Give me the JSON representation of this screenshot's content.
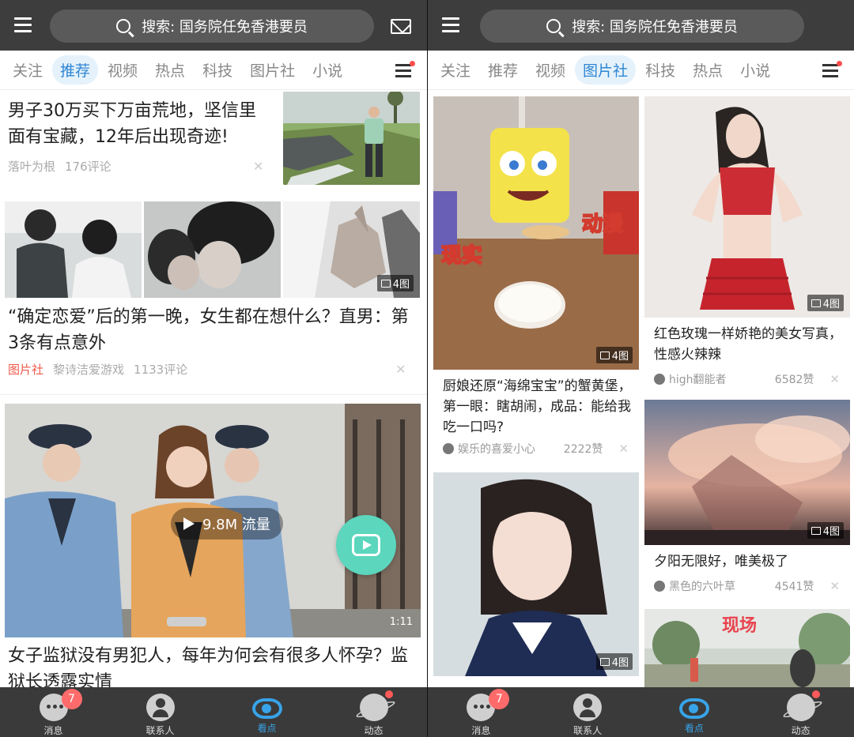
{
  "search": {
    "placeholder": "搜索: 国务院任免香港要员"
  },
  "left": {
    "tabs": [
      "关注",
      "推荐",
      "视频",
      "热点",
      "科技",
      "图片社",
      "小说"
    ],
    "active_tab": 1,
    "articles": [
      {
        "title": "男子30万买下万亩荒地，坚信里面有宝藏，12年后出现奇迹!",
        "source": "落叶为根",
        "comments": "176评论"
      },
      {
        "title": "“确定恋爱”后的第一晚，女生都在想什么？直男：第3条有点意外",
        "tag": "图片社",
        "source": "黎诗洁爱游戏",
        "comments": "1133评论",
        "image_count": "4图"
      }
    ],
    "video": {
      "views": "9.8M 流量",
      "duration": "1:11",
      "title": "女子监狱没有男犯人，每年为何会有很多人怀孕？监狱长透露实情"
    }
  },
  "right": {
    "tabs": [
      "关注",
      "推荐",
      "视频",
      "图片社",
      "科技",
      "热点",
      "小说"
    ],
    "active_tab": 3,
    "cards": [
      {
        "title": "厨娘还原“海绵宝宝”的蟹黄堡，第一眼：瞎胡闹，成品：能给我吃一口吗?",
        "author": "娱乐的喜爱小心",
        "likes": "2222赞",
        "image_count": "4图",
        "overlay_1": "动漫",
        "overlay_2": "现实"
      },
      {
        "title": "红色玫瑰一样娇艳的美女写真，性感火辣辣",
        "author": "high翻能者",
        "likes": "6582赞",
        "image_count": "4图"
      },
      {
        "title": "夕阳无限好，唯美极了",
        "author": "黑色的六叶草",
        "likes": "4541赞",
        "image_count": "4图"
      },
      {
        "image_count": "4图"
      },
      {
        "overlay": "现场"
      }
    ]
  },
  "close_glyph": "✕",
  "nav": [
    {
      "label": "消息",
      "badge": "7"
    },
    {
      "label": "联系人"
    },
    {
      "label": "看点"
    },
    {
      "label": "动态"
    }
  ],
  "colors": {
    "accent": "#2e86d4",
    "topbar": "#3d3d3d",
    "fab": "#5cd6bd",
    "badge": "#ff6b6b"
  }
}
